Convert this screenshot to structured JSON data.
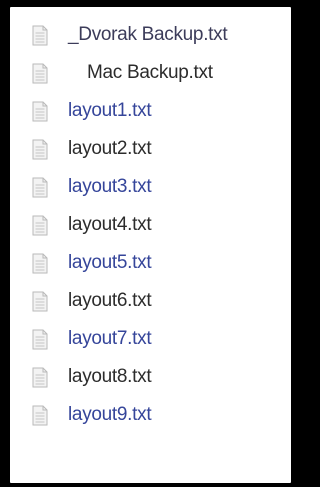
{
  "files": [
    {
      "name": "_Dvorak Backup.txt",
      "icon": "text-file-icon",
      "color": "#3c3c5a"
    },
    {
      "name": "Mac Backup.txt",
      "icon": "text-file-icon",
      "color": "#2b2b2b"
    },
    {
      "name": "layout1.txt",
      "icon": "text-file-icon",
      "color": "#35459a"
    },
    {
      "name": "layout2.txt",
      "icon": "text-file-icon",
      "color": "#2c2c2c"
    },
    {
      "name": "layout3.txt",
      "icon": "text-file-icon",
      "color": "#35459a"
    },
    {
      "name": "layout4.txt",
      "icon": "text-file-icon",
      "color": "#2c2c2c"
    },
    {
      "name": "layout5.txt",
      "icon": "text-file-icon",
      "color": "#35459a"
    },
    {
      "name": "layout6.txt",
      "icon": "text-file-icon",
      "color": "#2c2c2c"
    },
    {
      "name": "layout7.txt",
      "icon": "text-file-icon",
      "color": "#35459a"
    },
    {
      "name": "layout8.txt",
      "icon": "text-file-icon",
      "color": "#2c2c2c"
    },
    {
      "name": "layout9.txt",
      "icon": "text-file-icon",
      "color": "#35459a"
    }
  ]
}
